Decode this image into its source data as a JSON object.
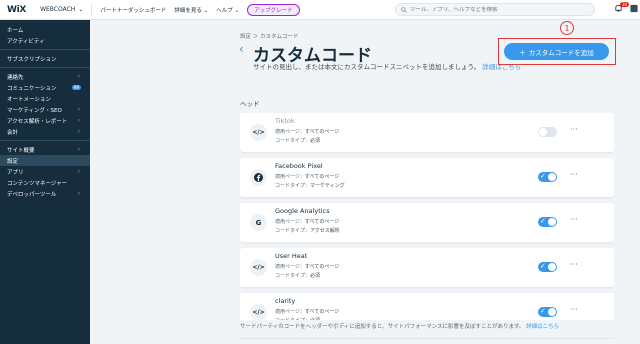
{
  "topbar": {
    "logo": "WiX",
    "site_name": "WEBCOACH",
    "links": [
      "パートナーダッシュボード",
      "詳細を見る",
      "ヘルプ"
    ],
    "upgrade_label": "アップグレード",
    "search_placeholder": "ツール、アプリ、ヘルプなどを検索",
    "notification_count": "30"
  },
  "sidebar": {
    "groups": [
      [
        {
          "label": "ホーム"
        },
        {
          "label": "アクティビティ"
        }
      ],
      [
        {
          "label": "サブスクリプション"
        }
      ],
      [
        {
          "label": "連絡先",
          "chevron": true
        },
        {
          "label": "コミュニケーション",
          "badge": "99"
        },
        {
          "label": "オートメーション"
        },
        {
          "label": "マーケティング・SEO",
          "chevron": true
        },
        {
          "label": "アクセス解析・レポート",
          "chevron": true
        },
        {
          "label": "会計",
          "chevron": true
        }
      ],
      [
        {
          "label": "サイト概要",
          "chevron": true
        },
        {
          "label": "設定",
          "active": true
        },
        {
          "label": "アプリ",
          "chevron": true
        },
        {
          "label": "コンテンツマネージャー"
        },
        {
          "label": "デベロッパーツール",
          "chevron": true
        }
      ]
    ]
  },
  "main": {
    "breadcrumb_root": "設定",
    "breadcrumb_current": "カスタムコード",
    "title": "カスタムコード",
    "description": "サイトの見出し、または本文にカスタムコードスニペットを追加しましょう。",
    "description_link": "詳細はこちら",
    "add_button": "カスタムコードを追加",
    "annotation_number": "1",
    "section_head": "ヘッド",
    "meta_keys": {
      "page": "適用ページ：",
      "type": "コードタイプ："
    },
    "codes": [
      {
        "name": "Tiktok",
        "page": "すべてのページ",
        "type": "必須",
        "enabled": false,
        "icon": "code-icon"
      },
      {
        "name": "Facebook Pixel",
        "page": "すべてのページ",
        "type": "マーケティング",
        "enabled": true,
        "icon": "facebook-icon"
      },
      {
        "name": "Google Analytics",
        "page": "すべてのページ",
        "type": "アクセス解析",
        "enabled": true,
        "icon": "google-icon"
      },
      {
        "name": "User Heat",
        "page": "すべてのページ",
        "type": "必須",
        "enabled": true,
        "icon": "code-icon"
      },
      {
        "name": "clarity",
        "page": "すべてのページ",
        "type": "必須",
        "enabled": true,
        "icon": "code-icon"
      }
    ],
    "footer_note": "サードパーティのコードをヘッダーやボディに追加すると、サイトパフォーマンスに影響を及ぼすことがあります。",
    "footer_link": "詳細はこちら"
  },
  "colors": {
    "accent": "#3899ec",
    "sidebar_bg": "#162d3d",
    "annotation": "#e03b3b",
    "upgrade": "#9a27d5"
  }
}
